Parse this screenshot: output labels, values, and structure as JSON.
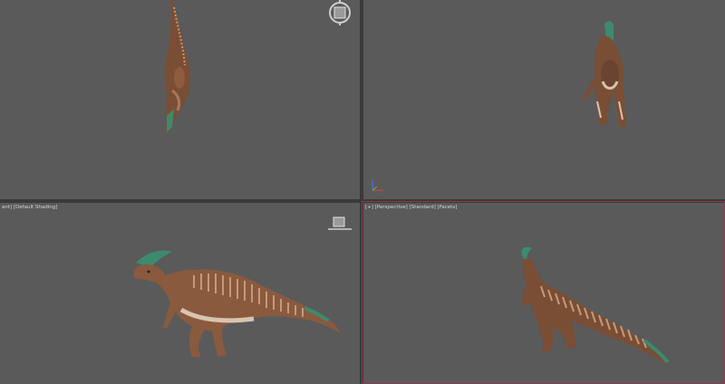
{
  "viewports": {
    "top": {
      "label": ""
    },
    "front": {
      "label": ""
    },
    "left": {
      "label": "ant] [Default Shading]"
    },
    "perspective": {
      "label": "[+] [Perspective] [Standard] [Facets]"
    }
  },
  "icons": {
    "viewcube_top": "viewcube-icon",
    "viewcube_left": "viewcube-icon",
    "axis_gizmo": "axis-tripod-icon"
  },
  "colors": {
    "viewport_bg": "#5a5a5a",
    "divider": "#3a3a3a",
    "active_border": "#8a3a4a",
    "dino_body": "#8a5a3e",
    "dino_stripe": "#c49a78",
    "dino_belly": "#d8c4b0",
    "dino_crest": "#3e8a6e"
  }
}
